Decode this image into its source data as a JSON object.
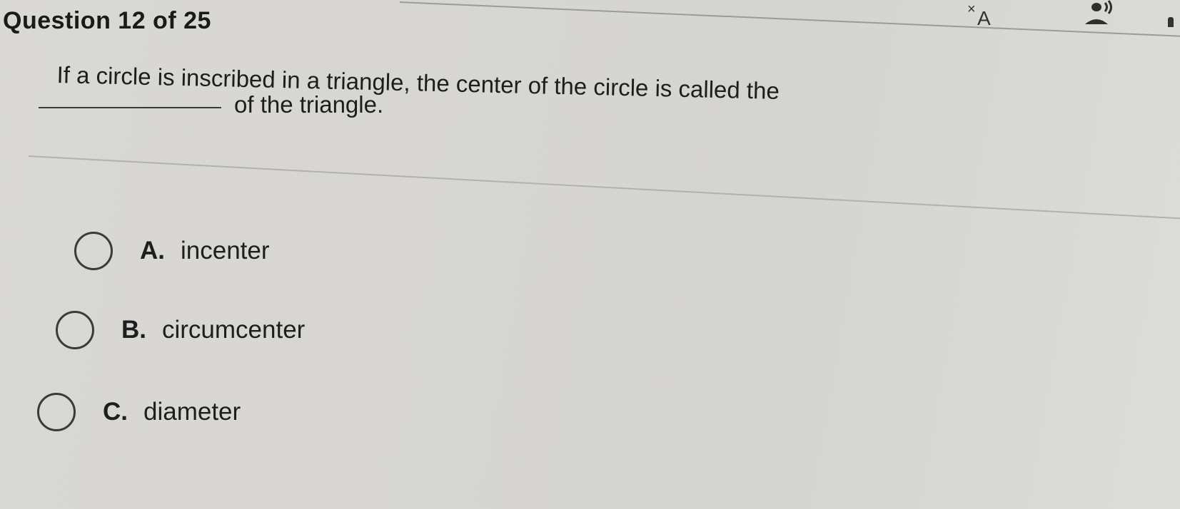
{
  "header": {
    "question_label": "Question 12 of 25",
    "icons": [
      "translate-icon",
      "audio-icon"
    ]
  },
  "question": {
    "prompt_line1": "If a circle is inscribed in a triangle, the center of the circle is called the",
    "prompt_line2": "of the triangle."
  },
  "options": [
    {
      "letter": "A.",
      "text": "incenter",
      "selected": false
    },
    {
      "letter": "B.",
      "text": "circumcenter",
      "selected": false
    },
    {
      "letter": "C.",
      "text": "diameter",
      "selected": false
    }
  ],
  "colors": {
    "background": "#d8d7d3",
    "text": "#1e1e1e",
    "radio_border": "#3a3a3a"
  }
}
